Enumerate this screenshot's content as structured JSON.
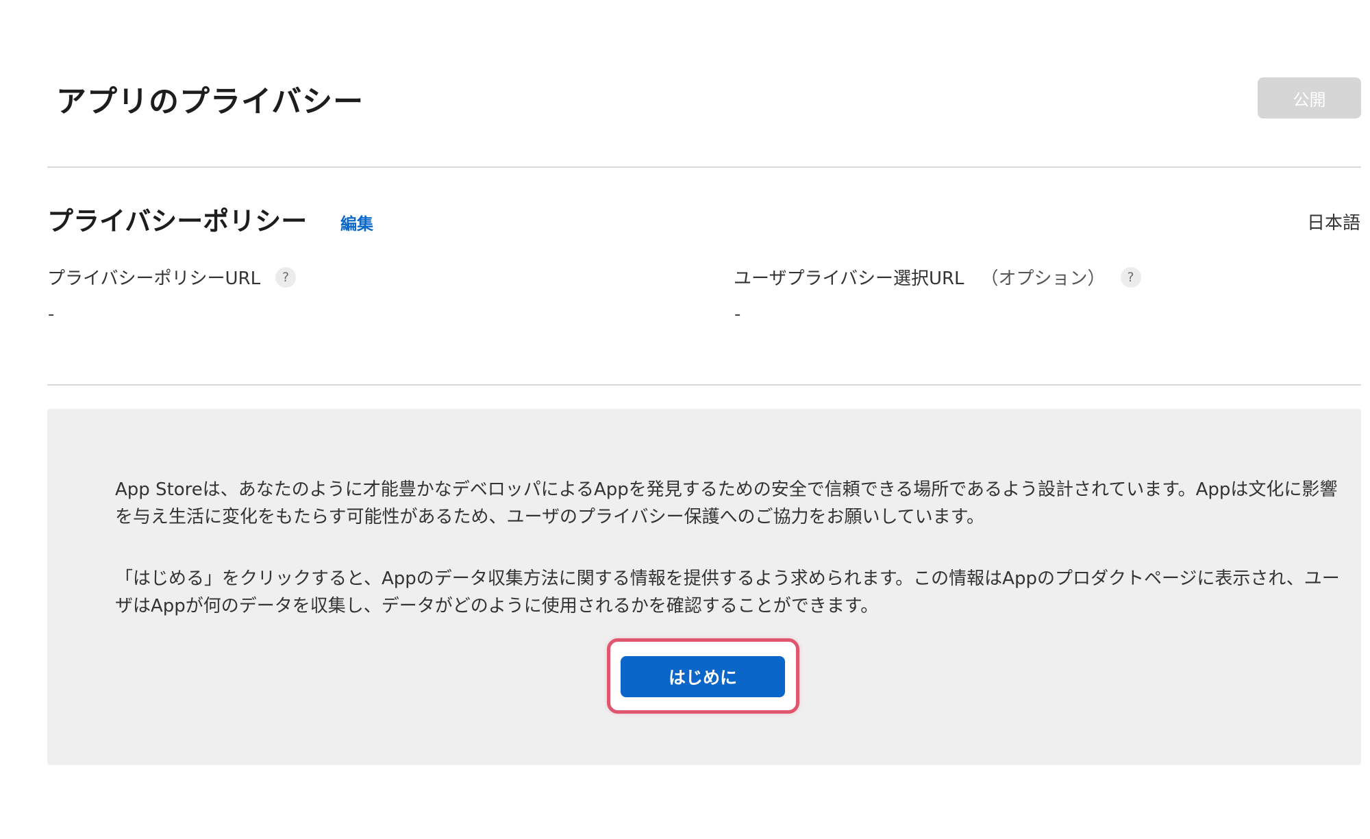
{
  "header": {
    "title": "アプリのプライバシー",
    "publish_label": "公開"
  },
  "privacy_policy": {
    "title": "プライバシーポリシー",
    "edit_label": "編集",
    "language": "日本語",
    "url_label": "プライバシーポリシーURL",
    "url_value": "-",
    "choices_label": "ユーザプライバシー選択URL",
    "choices_optional": "（オプション）",
    "choices_value": "-",
    "help_glyph": "?"
  },
  "info": {
    "paragraph1": "App Storeは、あなたのように才能豊かなデベロッパによるAppを発見するための安全で信頼できる場所であるよう設計されています。Appは文化に影響を与え生活に変化をもたらす可能性があるため、ユーザのプライバシー保護へのご協力をお願いしています。",
    "paragraph2": "「はじめる」をクリックすると、Appのデータ収集方法に関する情報を提供するよう求められます。この情報はAppのプロダクトページに表示され、ユーザはAppが何のデータを収集し、データがどのように使用されるかを確認することができます。",
    "start_label": "はじめに"
  },
  "colors": {
    "link": "#0b67c9",
    "primary_button": "#0a66c8",
    "highlight": "#e0566e",
    "disabled_button": "#d6d6d6",
    "panel_bg": "#efeff0"
  }
}
